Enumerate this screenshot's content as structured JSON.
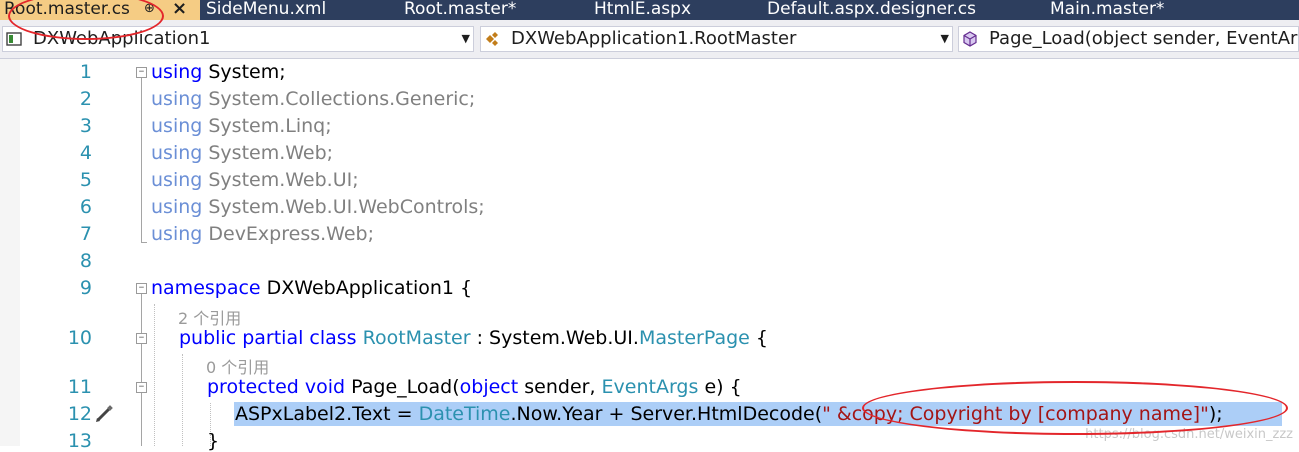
{
  "tabs": [
    {
      "label": "Root.master.cs",
      "active": true
    },
    {
      "label": "SideMenu.xml"
    },
    {
      "label": "Root.master*"
    },
    {
      "label": "HtmlE.aspx"
    },
    {
      "label": "Default.aspx.designer.cs"
    },
    {
      "label": "Main.master*"
    }
  ],
  "tab_pin_glyph": "⊕",
  "tab_close_glyph": "×",
  "nav": {
    "project": "DXWebApplication1",
    "class": "DXWebApplication1.RootMaster",
    "member": "Page_Load(object sender, EventArgs e)"
  },
  "line_numbers": [
    "1",
    "2",
    "3",
    "4",
    "5",
    "6",
    "7",
    "8",
    "9",
    "10",
    "11",
    "12",
    "13"
  ],
  "code": {
    "l1_kw": "using",
    "l1_rest": " System;",
    "l2_kw": "using",
    "l2_rest": " System.Collections.Generic;",
    "l3_kw": "using",
    "l3_rest": " System.Linq;",
    "l4_kw": "using",
    "l4_rest": " System.Web;",
    "l5_kw": "using",
    "l5_rest": " System.Web.UI;",
    "l6_kw": "using",
    "l6_rest": " System.Web.UI.WebControls;",
    "l7_kw": "using",
    "l7_rest": " DevExpress.Web;",
    "l9_kw": "namespace",
    "l9_rest": " DXWebApplication1 {",
    "lens1": "2 个引用",
    "l10_kw": "public partial class",
    "l10_type": "RootMaster",
    "l10_mid": " : System.Web.UI.",
    "l10_type2": "MasterPage",
    "l10_end": " {",
    "lens2": "0 个引用",
    "l11_kw": "protected void",
    "l11_mid": " Page_Load(",
    "l11_kw2": "object",
    "l11_mid2": " sender, ",
    "l11_type": "EventArgs",
    "l11_end": " e) {",
    "l12_a": "ASPxLabel2.Text = ",
    "l12_type": "DateTime",
    "l12_b": ".Now.Year + Server.HtmlDecode(",
    "l12_str": "\" &copy; Copyright by [company name]\"",
    "l12_end": ");",
    "l13": "}"
  },
  "watermark": "https://blog.csdn.net/weixin_zzz",
  "colors": {
    "keyword": "#0000ff",
    "type": "#2b91af",
    "string": "#a31515",
    "annotation": "#e3262b",
    "active_tab": "#f5cc84"
  }
}
